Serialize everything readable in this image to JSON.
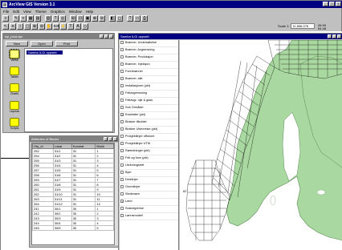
{
  "app": {
    "title": "ArcView GIS Version 3.1",
    "menu": [
      "File",
      "Edit",
      "View",
      "Theme",
      "Graphics",
      "Window",
      "Help"
    ],
    "scale_label": "Scale 1:",
    "scale_value": "11,656,076",
    "coord_readout": "26.99\n64.48"
  },
  "project": {
    "title": "isp_prod.apr",
    "buttons": {
      "new": "New",
      "open": "Open",
      "print": "Print"
    },
    "doc_types": [
      {
        "label": "Views"
      },
      {
        "label": "Tables"
      },
      {
        "label": "Charts"
      },
      {
        "label": "Layouts"
      },
      {
        "label": "Scripts"
      }
    ],
    "items": [
      "Samba ILGI oppsett"
    ]
  },
  "attributes": {
    "title": "Attributes of Blocks",
    "columns": [
      "Obj_id",
      "Lokal",
      "Kvadrat",
      "Blokk"
    ],
    "rows": [
      [
        "252",
        "31/1",
        "31",
        "1"
      ],
      [
        "254",
        "31/2",
        "31",
        "2"
      ],
      [
        "255",
        "31/3",
        "31",
        "3"
      ],
      [
        "256",
        "31/4",
        "31",
        "4"
      ],
      [
        "257",
        "31/5",
        "31",
        "5"
      ],
      [
        "258",
        "31/6",
        "31",
        "6"
      ],
      [
        "259",
        "31/7",
        "31",
        "7"
      ],
      [
        "260",
        "31/8",
        "31",
        "8"
      ],
      [
        "261",
        "31/9",
        "31",
        "9"
      ],
      [
        "262",
        "31/10",
        "31",
        "10"
      ],
      [
        "263",
        "31/11",
        "31",
        "11"
      ],
      [
        "264",
        "31/12",
        "31",
        "12"
      ],
      [
        "241",
        "30/1",
        "30",
        "1"
      ],
      [
        "242",
        "30/2",
        "30",
        "2"
      ],
      [
        "243",
        "30/3",
        "30",
        "3"
      ],
      [
        "244",
        "30/4",
        "30",
        "4"
      ],
      [
        "245",
        "30/5",
        "30",
        "5"
      ]
    ]
  },
  "view": {
    "title": "Samba ILGI oppsett",
    "legend": [
      {
        "label": "Brønner, Undersøkelse",
        "checked": false
      },
      {
        "label": "Brønner, Avgrensning",
        "checked": false
      },
      {
        "label": "Brønner, Produksjon",
        "checked": false
      },
      {
        "label": "Brønner, Injeksjon",
        "checked": false
      },
      {
        "label": "Funnbrønner",
        "checked": false
      },
      {
        "label": "Brønner, alle",
        "checked": false
      },
      {
        "label": "Installasjoner (pkt)",
        "checked": false
      },
      {
        "label": "Feltavgrensning",
        "checked": false
      },
      {
        "label": "Feltavgr. olje & gass",
        "checked": false
      },
      {
        "label": "Sub Områder",
        "checked": false
      },
      {
        "label": "Kvadrater (pkt)",
        "checked": true
      },
      {
        "label": "Blokker tilkoblet",
        "checked": false
      },
      {
        "label": "Blokker Utvinnelse (pkt)",
        "checked": false
      },
      {
        "label": "Prosjektlinjer offshore",
        "checked": false
      },
      {
        "label": "Prosjektlinjer UTM",
        "checked": false
      },
      {
        "label": "Rørledninger (pkt)",
        "checked": false
      },
      {
        "label": "Felt og funn (pkt)",
        "checked": false
      },
      {
        "label": "Utvinningsrett",
        "checked": false
      },
      {
        "label": "Byer",
        "checked": false
      },
      {
        "label": "Delelinjer",
        "checked": false
      },
      {
        "label": "Grunnlinjer",
        "checked": false
      },
      {
        "label": "Stedsnavn",
        "checked": false
      },
      {
        "label": "Land",
        "checked": true
      },
      {
        "label": "Sokkelgrense",
        "checked": false
      },
      {
        "label": "Lønnsmodell",
        "checked": false
      }
    ],
    "map_label": "62"
  },
  "colors": {
    "titlebar_active": "#000080",
    "titlebar_inactive": "#808080",
    "face": "#c0c0c0",
    "land": "#a9d8a0",
    "selection": "#000080"
  }
}
